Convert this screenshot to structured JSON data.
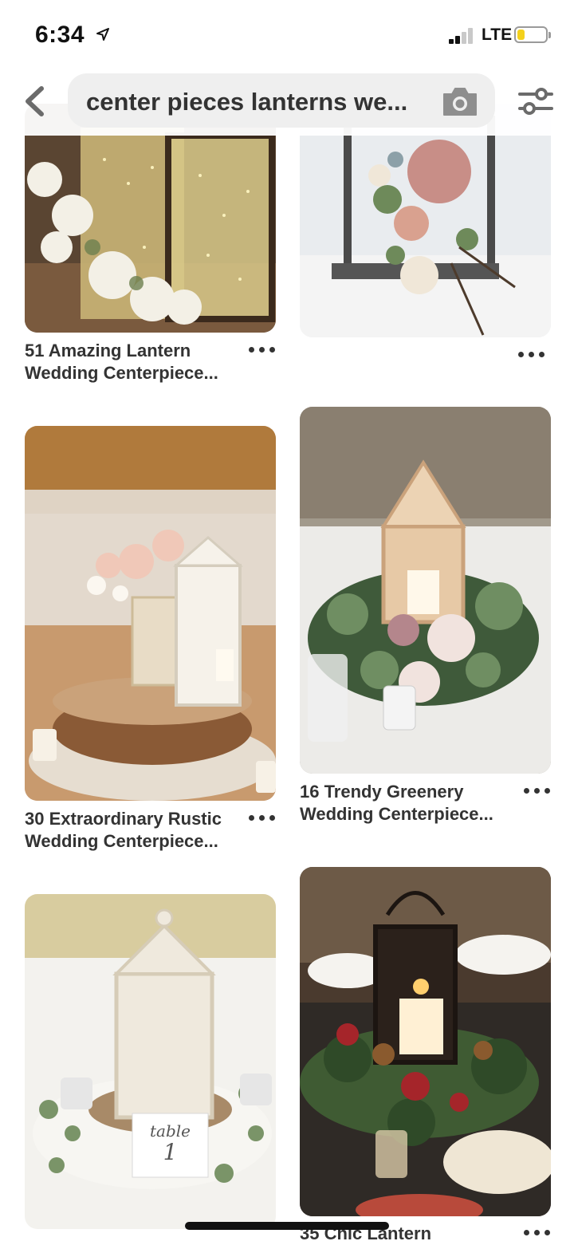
{
  "status_bar": {
    "time": "6:34",
    "network": "LTE"
  },
  "search": {
    "query": "center pieces lanterns we..."
  },
  "pins": [
    {
      "title_line1": "51 Amazing Lantern",
      "title_line2": "Wedding Centerpiece..."
    },
    {
      "title_line1": "",
      "title_line2": ""
    },
    {
      "title_line1": "30 Extraordinary Rustic",
      "title_line2": "Wedding Centerpiece..."
    },
    {
      "title_line1": "16 Trendy Greenery",
      "title_line2": "Wedding Centerpiece..."
    },
    {
      "title_line1": "",
      "title_line2": ""
    },
    {
      "title_line1": "35 Chic Lantern",
      "title_line2": ""
    }
  ],
  "pin5_table_card": {
    "line1": "table",
    "line2": "1"
  },
  "icons": [
    "location-arrow-icon",
    "signal-icon",
    "battery-icon",
    "back-chevron-icon",
    "camera-icon",
    "filter-icon",
    "more-options-icon"
  ],
  "colors": {
    "battery": "#f4d11c",
    "text": "#333333",
    "search_bg": "#efefef"
  }
}
